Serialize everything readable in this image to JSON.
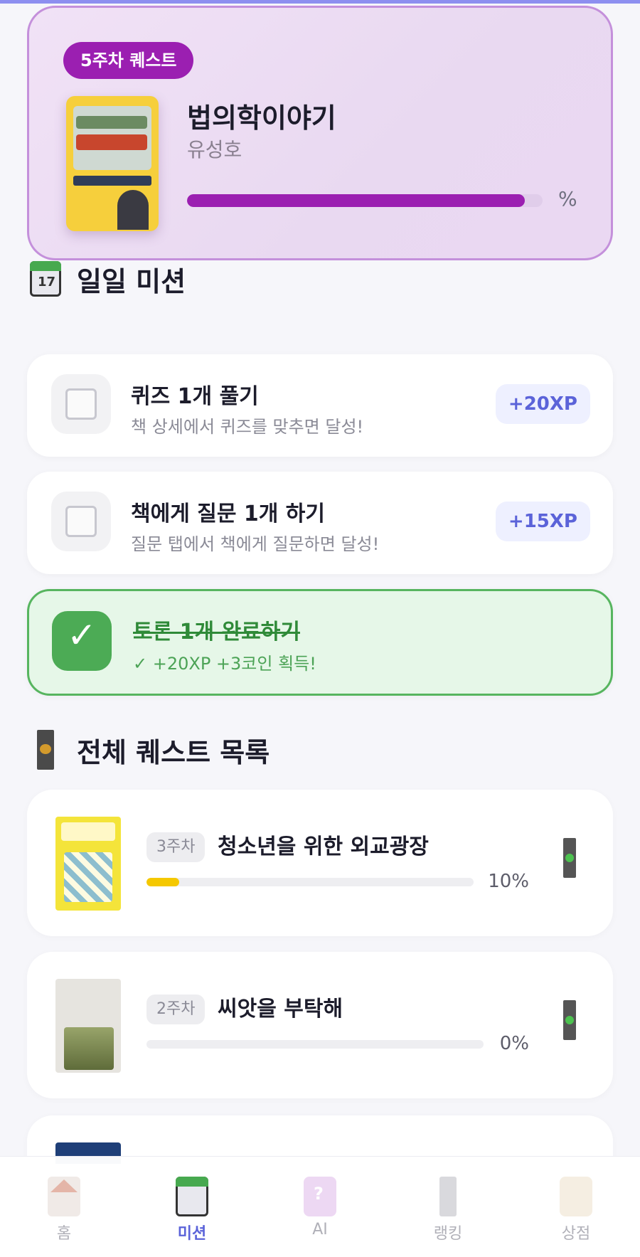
{
  "hero": {
    "badge": "5주차 퀘스트",
    "book_title": "법의학이야기",
    "author": "유성호",
    "progress_percent_label": "%",
    "progress_fraction": 0.95
  },
  "daily": {
    "title": "일일 미션",
    "icon": "calendar-icon",
    "missions": [
      {
        "title": "퀴즈 1개 풀기",
        "desc": "책 상세에서 퀴즈를 맞추면 달성!",
        "xp": "+20XP",
        "done": false
      },
      {
        "title": "책에게 질문 1개 하기",
        "desc": "질문 탭에서 책에게 질문하면 달성!",
        "xp": "+15XP",
        "done": false
      },
      {
        "title": "토론 1개 완료하기",
        "desc": "✓ +20XP +3코인 획득!",
        "check_glyph": "✓",
        "done": true
      }
    ]
  },
  "quests": {
    "title": "전체 퀘스트 목록",
    "icon": "door-icon",
    "items": [
      {
        "week": "3주차",
        "title": "청소년을 위한 외교광장",
        "percent": "10%",
        "progress": 0.1
      },
      {
        "week": "2주차",
        "title": "씨앗을 부탁해",
        "percent": "0%",
        "progress": 0.0
      }
    ]
  },
  "nav": {
    "items": [
      {
        "label": "홈",
        "icon": "home-icon",
        "active": false
      },
      {
        "label": "미션",
        "icon": "calendar-icon",
        "active": true
      },
      {
        "label": "AI",
        "icon": "ai-chat-icon",
        "active": false
      },
      {
        "label": "랭킹",
        "icon": "trophy-icon",
        "active": false
      },
      {
        "label": "상점",
        "icon": "shop-icon",
        "active": false
      }
    ]
  },
  "colors": {
    "accent": "#5b63d9",
    "hero_badge": "#9b1fb1",
    "done_green": "#4cab55",
    "quest_bar": "#f5c800"
  }
}
